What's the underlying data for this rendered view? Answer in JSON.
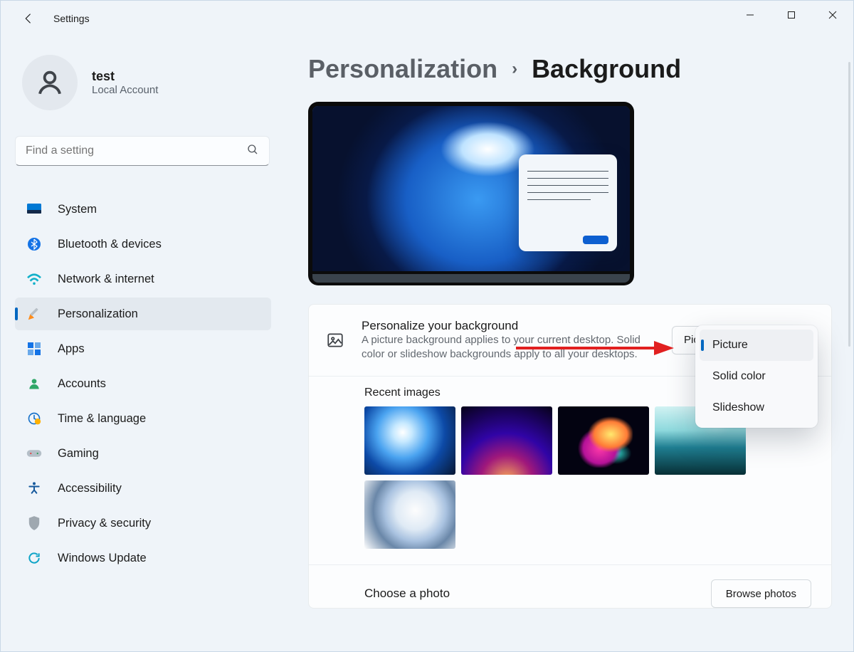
{
  "window": {
    "back_icon": "arrow-left",
    "app_title": "Settings"
  },
  "account": {
    "name": "test",
    "type": "Local Account"
  },
  "search": {
    "placeholder": "Find a setting"
  },
  "sidebar": {
    "items": [
      {
        "icon": "system-icon",
        "label": "System"
      },
      {
        "icon": "bluetooth-icon",
        "label": "Bluetooth & devices"
      },
      {
        "icon": "network-icon",
        "label": "Network & internet"
      },
      {
        "icon": "personalization-icon",
        "label": "Personalization",
        "selected": true
      },
      {
        "icon": "apps-icon",
        "label": "Apps"
      },
      {
        "icon": "accounts-icon",
        "label": "Accounts"
      },
      {
        "icon": "time-language-icon",
        "label": "Time & language"
      },
      {
        "icon": "gaming-icon",
        "label": "Gaming"
      },
      {
        "icon": "accessibility-icon",
        "label": "Accessibility"
      },
      {
        "icon": "privacy-icon",
        "label": "Privacy & security"
      },
      {
        "icon": "windows-update-icon",
        "label": "Windows Update"
      }
    ]
  },
  "breadcrumb": {
    "parent": "Personalization",
    "current": "Background"
  },
  "personalize": {
    "heading": "Personalize your background",
    "description": "A picture background applies to your current desktop. Solid color or slideshow backgrounds apply to all your desktops.",
    "selected": "Picture",
    "options": [
      "Picture",
      "Solid color",
      "Slideshow"
    ]
  },
  "recent": {
    "label": "Recent images"
  },
  "choose": {
    "label": "Choose a photo",
    "button": "Browse photos"
  },
  "colors": {
    "accent": "#0067c0",
    "bg": "#eff4f9"
  }
}
